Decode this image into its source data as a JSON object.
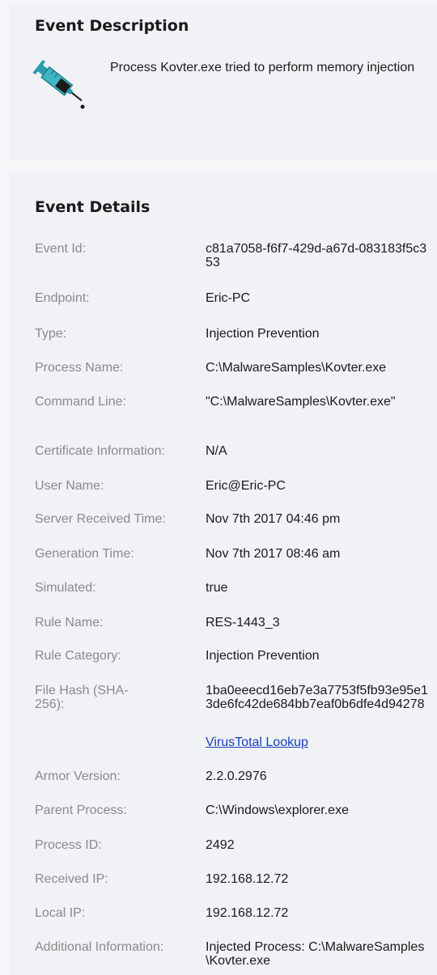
{
  "description": {
    "title": "Event Description",
    "icon": "syringe-icon",
    "text": "Process Kovter.exe tried to perform memory injection"
  },
  "details": {
    "title": "Event Details",
    "rows": [
      {
        "label": "Event Id:",
        "value": "c81a7058-f6f7-429d-a67d-083183f5c353"
      },
      {
        "label": "Endpoint:",
        "value": "Eric-PC"
      },
      {
        "label": "Type:",
        "value": "Injection Prevention"
      },
      {
        "label": "Process Name:",
        "value": "C:\\MalwareSamples\\Kovter.exe"
      },
      {
        "label": "Command Line:",
        "value": "\"C:\\MalwareSamples\\Kovter.exe\""
      },
      {
        "label": "Certificate Information:",
        "value": "N/A"
      },
      {
        "label": "User Name:",
        "value": "Eric@Eric-PC"
      },
      {
        "label": "Server Received Time:",
        "value": "Nov 7th 2017 04:46 pm"
      },
      {
        "label": "Generation Time:",
        "value": "Nov 7th 2017 08:46 am"
      },
      {
        "label": "Simulated:",
        "value": "true"
      },
      {
        "label": "Rule Name:",
        "value": "RES-1443_3"
      },
      {
        "label": "Rule Category:",
        "value": "Injection Prevention"
      },
      {
        "label": "File Hash (SHA-256):",
        "value": "1ba0eeecd16eb7e3a7753f5fb93e95e13de6fc42de684bb7eaf0b6dfe4d94278",
        "link": "VirusTotal Lookup"
      },
      {
        "label": "Armor Version:",
        "value": "2.2.0.2976"
      },
      {
        "label": "Parent Process:",
        "value": "C:\\Windows\\explorer.exe"
      },
      {
        "label": "Process ID:",
        "value": "2492"
      },
      {
        "label": "Received IP:",
        "value": "192.168.12.72"
      },
      {
        "label": "Local IP:",
        "value": "192.168.12.72"
      },
      {
        "label": "Additional Information:",
        "value": "Injected Process: C:\\MalwareSamples\\Kovter.exe"
      }
    ]
  }
}
